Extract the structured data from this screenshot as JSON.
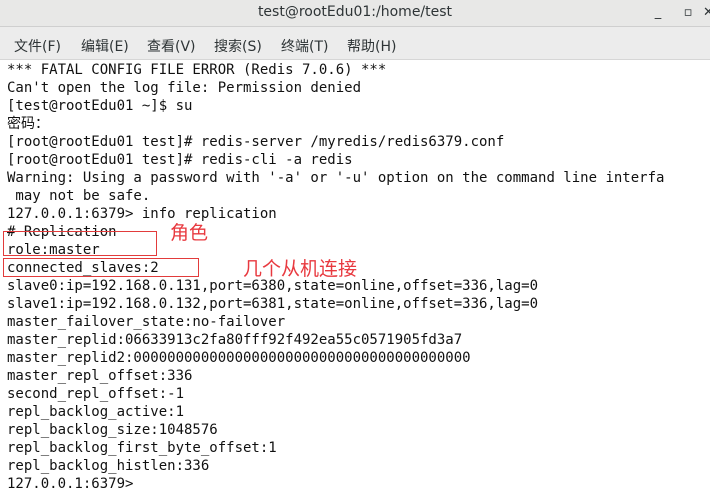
{
  "window": {
    "title": "test@rootEdu01:/home/test",
    "minimize_glyph": "_",
    "maximize_glyph": "▫",
    "close_glyph": "✕"
  },
  "menu": {
    "items": [
      "文件(F)",
      "编辑(E)",
      "查看(V)",
      "搜索(S)",
      "终端(T)",
      "帮助(H)"
    ]
  },
  "terminal": {
    "lines": [
      "*** FATAL CONFIG FILE ERROR (Redis 7.0.6) ***",
      "Can't open the log file: Permission denied",
      "[test@rootEdu01 ~]$ su",
      "密码：",
      "[root@rootEdu01 test]# redis-server /myredis/redis6379.conf",
      "[root@rootEdu01 test]# redis-cli -a redis",
      "Warning: Using a password with '-a' or '-u' option on the command line interfa",
      " may not be safe.",
      "127.0.0.1:6379> info replication",
      "# Replication",
      "role:master",
      "connected_slaves:2",
      "slave0:ip=192.168.0.131,port=6380,state=online,offset=336,lag=0",
      "slave1:ip=192.168.0.132,port=6381,state=online,offset=336,lag=0",
      "master_failover_state:no-failover",
      "master_replid:06633913c2fa80fff92f492ea55c0571905fd3a7",
      "master_replid2:0000000000000000000000000000000000000000",
      "master_repl_offset:336",
      "second_repl_offset:-1",
      "repl_backlog_active:1",
      "repl_backlog_size:1048576",
      "repl_backlog_first_byte_offset:1",
      "repl_backlog_histlen:336",
      "127.0.0.1:6379>"
    ]
  },
  "annotations": {
    "role_label": "角色",
    "slaves_label": "几个从机连接",
    "color": "#e8393f"
  }
}
